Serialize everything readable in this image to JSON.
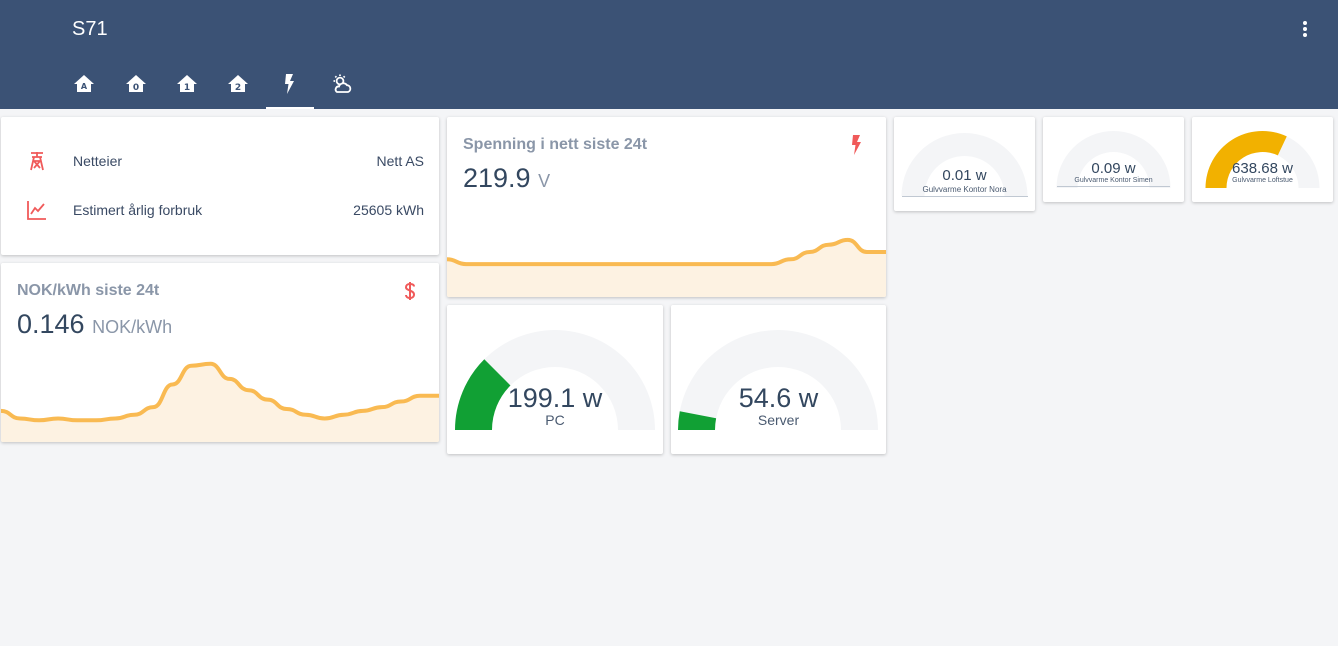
{
  "header": {
    "title": "S71",
    "tabs": [
      {
        "icon": "home-floor-a-icon",
        "active": false
      },
      {
        "icon": "home-floor-0-icon",
        "active": false
      },
      {
        "icon": "home-floor-1-icon",
        "active": false
      },
      {
        "icon": "home-floor-2-icon",
        "active": false
      },
      {
        "icon": "flash-icon",
        "active": true
      },
      {
        "icon": "weather-partly-cloudy-icon",
        "active": false
      }
    ],
    "menu_icon": "dots-vertical-icon"
  },
  "entities": [
    {
      "icon": "transmission-tower-icon",
      "name": "Netteier",
      "value": "Nett AS"
    },
    {
      "icon": "chart-line-icon",
      "name": "Estimert årlig forbruk",
      "value": "25605 kWh"
    }
  ],
  "price_sensor": {
    "name": "NOK/kWh siste 24t",
    "value": "0.146",
    "unit": "NOK/kWh",
    "icon": "currency-usd-icon"
  },
  "voltage_sensor": {
    "name": "Spenning i nett siste 24t",
    "value": "219.9",
    "unit": "V",
    "icon": "flash-icon"
  },
  "gauges": [
    {
      "id": "pc",
      "value": "199.1 w",
      "name": "PC",
      "fraction": 0.25,
      "color": "#11a034"
    },
    {
      "id": "server",
      "value": "54.6 w",
      "name": "Server",
      "fraction": 0.06,
      "color": "#11a034"
    }
  ],
  "small_gauges": [
    {
      "id": "kontor-nora",
      "value": "0.01 w",
      "name": "Gulvvarme Kontor Nora",
      "fraction": 0.0,
      "color": "#11a034"
    },
    {
      "id": "kontor-simen",
      "value": "0.09 w",
      "name": "Gulvvarme Kontor Simen",
      "fraction": 0.0,
      "color": "#11a034"
    },
    {
      "id": "loftstue",
      "value": "638.68 w",
      "name": "Gulvvarme Loftstue",
      "fraction": 0.64,
      "color": "#f2b100"
    }
  ],
  "colors": {
    "header": "#3b5275",
    "accent_icon": "#f05a5a",
    "graph_line": "#f9ba52",
    "graph_fill": "#fdf2e2",
    "gauge_track": "#f4f5f7"
  },
  "price_history": [
    0.138,
    0.134,
    0.133,
    0.134,
    0.133,
    0.133,
    0.134,
    0.136,
    0.14,
    0.152,
    0.162,
    0.163,
    0.155,
    0.149,
    0.144,
    0.139,
    0.136,
    0.134,
    0.136,
    0.138,
    0.14,
    0.143,
    0.146,
    0.146
  ],
  "voltage_history": [
    219.6,
    219.4,
    219.4,
    219.4,
    219.4,
    219.4,
    219.4,
    219.4,
    219.4,
    219.4,
    219.4,
    219.4,
    219.4,
    219.4,
    219.4,
    219.4,
    219.4,
    219.4,
    219.6,
    219.9,
    220.2,
    220.4,
    219.9,
    219.9
  ]
}
